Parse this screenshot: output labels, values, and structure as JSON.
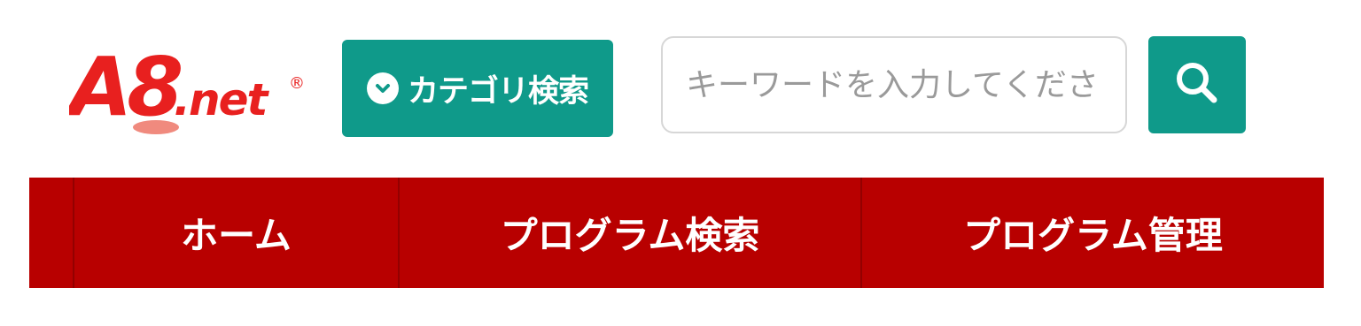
{
  "brand": {
    "logo_text_main": "A8",
    "logo_text_suffix": ".net",
    "logo_mark": "®",
    "logo_color": "#e8201f"
  },
  "header": {
    "category_button_label": "カテゴリ検索",
    "category_icon": "chevron-down-circle-icon",
    "search_placeholder": "キーワードを入力してください",
    "search_value": "",
    "search_icon": "search-icon",
    "accent_color": "#0f9a8a"
  },
  "nav": {
    "bar_color": "#b80000",
    "items": [
      {
        "label": "ホーム"
      },
      {
        "label": "プログラム検索"
      },
      {
        "label": "プログラム管理"
      }
    ]
  }
}
